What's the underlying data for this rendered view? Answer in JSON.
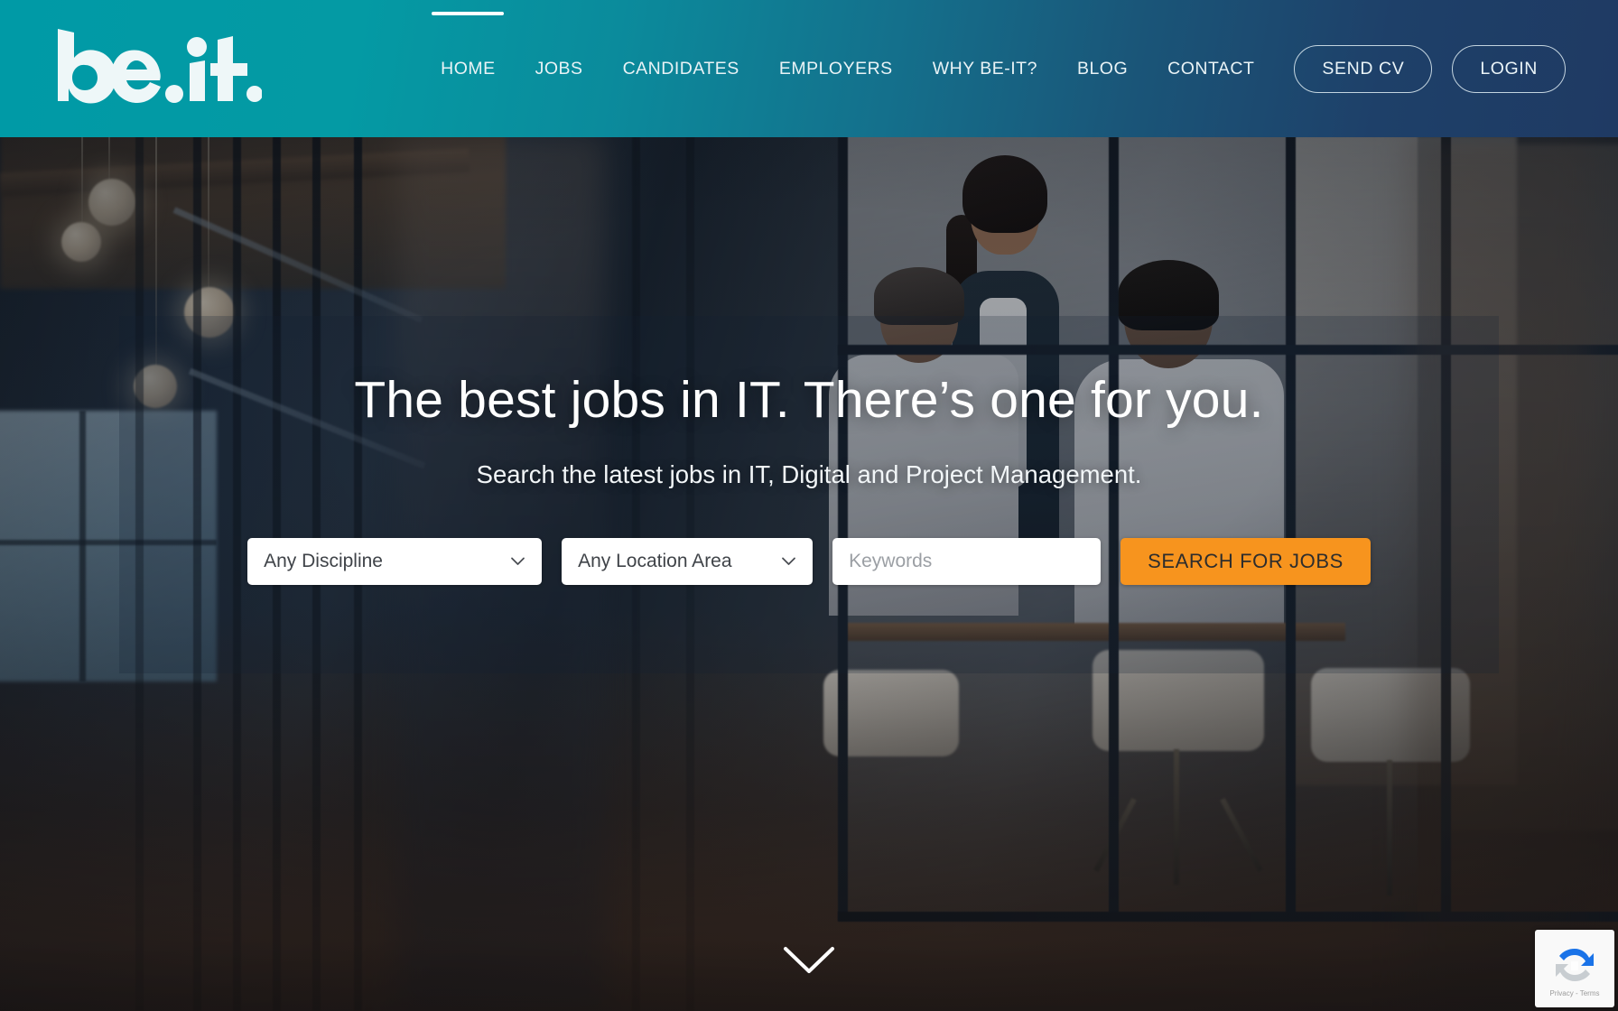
{
  "brand": {
    "logo_text": "be.it.",
    "logo_alt": "be-it-logo"
  },
  "colors": {
    "header_gradient_start": "#009aa6",
    "header_gradient_end": "#1f3a63",
    "accent_orange": "#f7941e",
    "nav_text": "#e9f3f6",
    "field_bg": "#ffffff",
    "field_text": "#3f4348",
    "placeholder_text": "#9b9fa4"
  },
  "nav": {
    "items": [
      {
        "label": "HOME",
        "active": true
      },
      {
        "label": "JOBS",
        "active": false
      },
      {
        "label": "CANDIDATES",
        "active": false
      },
      {
        "label": "EMPLOYERS",
        "active": false
      },
      {
        "label": "WHY BE-IT?",
        "active": false
      },
      {
        "label": "BLOG",
        "active": false
      },
      {
        "label": "CONTACT",
        "active": false
      }
    ],
    "send_cv_label": "SEND CV",
    "login_label": "LOGIN"
  },
  "hero": {
    "title": "The best jobs in IT. There’s one for you.",
    "subtitle": "Search the latest jobs in IT, Digital and Project Management."
  },
  "search": {
    "discipline": {
      "value": "Any Discipline",
      "icon": "chevron-down-icon"
    },
    "location": {
      "value": "Any Location Area",
      "icon": "chevron-down-icon"
    },
    "keywords": {
      "value": "",
      "placeholder": "Keywords"
    },
    "submit_label": "SEARCH FOR JOBS"
  },
  "scroll_indicator": {
    "icon": "chevron-down-icon"
  },
  "recaptcha": {
    "text": "Privacy - Terms",
    "icon": "recaptcha-icon"
  }
}
